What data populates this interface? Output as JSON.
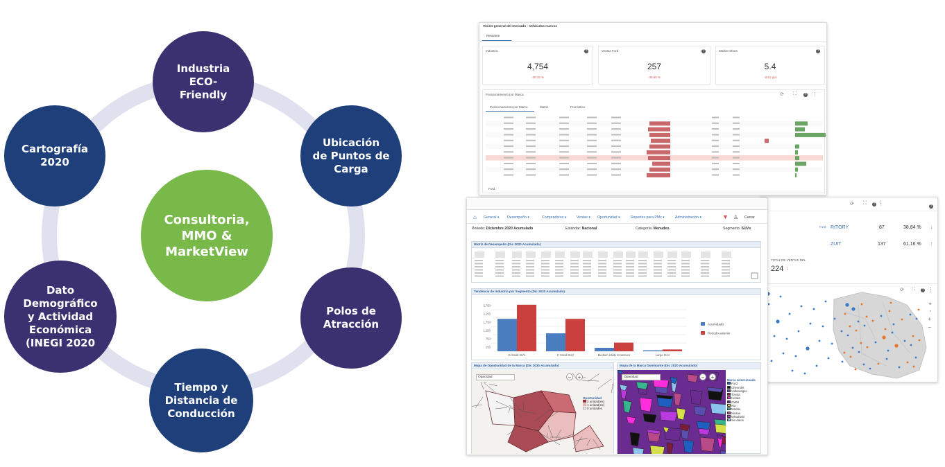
{
  "diagram": {
    "center": "Consultoria,\nMMO &\nMarketView",
    "nodes": [
      "Industria\nECO-\nFriendly",
      "Ubicación\nde Puntos de\nCarga",
      "Polos de\nAtracción",
      "Tiempo y\nDistancia de\nConducción",
      "Dato\nDemográfico\ny Actividad\nEconómica\n(INEGI 2020",
      "Cartografía\n2020"
    ],
    "colors": {
      "ring": "#dfe2ee",
      "primary": "#3b3171",
      "secondary": "#1e3f7a",
      "center": "#78b94a"
    }
  },
  "top_panel": {
    "title": "Visión general del mercado - Vehículos nuevos",
    "tab": "Resumen",
    "kpis": [
      {
        "label": "Industria",
        "value": "4,754",
        "delta": "-30.15 %",
        "color": "#d9534f"
      },
      {
        "label": "Ventas Ford",
        "value": "257",
        "delta": "-35.65 %",
        "color": "#d9534f"
      },
      {
        "label": "Market Share",
        "value": "5.4",
        "delta": "-0.51 ppt",
        "color": "#d9534f"
      }
    ],
    "section_title": "Posicionamiento por Marca",
    "subtabs": [
      "Posicionamiento por Marca",
      "Matriz",
      "Pronóstico"
    ],
    "footer": "Ford"
  },
  "bottom_panel": {
    "nav": [
      "General",
      "Desempeño",
      "Compradores",
      "Ventas",
      "Oportunidad",
      "Reportes para PMs",
      "Administración"
    ],
    "close_label": "Cerrar",
    "filters": [
      {
        "label": "Periodo:",
        "value": "Diciembre 2020 Acumulado"
      },
      {
        "label": "Estándar:",
        "value": "Nacional"
      },
      {
        "label": "Categoría:",
        "value": "Menudeo"
      },
      {
        "label": "Segmento:",
        "value": "SUVs"
      }
    ],
    "matrix_title": "Matriz de Desempeño (Dic 2020 Acumulado)",
    "trend_title": "Tendencia de Industria por Segmento (Dic 2020 Acumulado)",
    "map1_title": "Mapa de Oportunidad de la Marca (Dic 2020 Acumulado)",
    "map2_title": "Mapa de la Marca Dominante (Dic 2020 Acumulado)",
    "opacity_label": "Opacidad",
    "map1_legend_title": "Oportunidad",
    "map1_legend": [
      "2 unidad(es)",
      "1 unidad(es)",
      "0 unidades"
    ],
    "map2_legend_title": "Marca seleccionada",
    "map2_legend": [
      "Ford",
      "Chevrolet",
      "Volkswagen",
      "Toyota",
      "Honda",
      "GWM",
      "Kia",
      "Mazda",
      "Nissan",
      "Mitsubishi",
      "Sin datos"
    ]
  },
  "chart_data": {
    "type": "bar",
    "categories": [
      "B Small SUV",
      "C Small SUV",
      "Medium Utility Crossover",
      "Large SUV"
    ],
    "series": [
      {
        "name": "Acumulado",
        "values": [
          1950,
          1080,
          210,
          60
        ],
        "color": "#4a7cc0"
      },
      {
        "name": "Periodo anterior",
        "values": [
          2800,
          1950,
          520,
          110
        ],
        "color": "#c9403e"
      }
    ],
    "y_ticks": [
      "2,750",
      "2,250",
      "1,750",
      "1,250",
      "750",
      "250"
    ],
    "ylim": [
      0,
      3000
    ]
  },
  "right_panel": {
    "rows": [
      {
        "name": "RITORY",
        "v": "87",
        "pct": "38.84 %"
      },
      {
        "name": "ZUIT",
        "v": "137",
        "pct": "61.16 %"
      }
    ],
    "total_label": "TOTAL DE VENTAS DEL",
    "total_value": "224",
    "ford": "Ford"
  }
}
